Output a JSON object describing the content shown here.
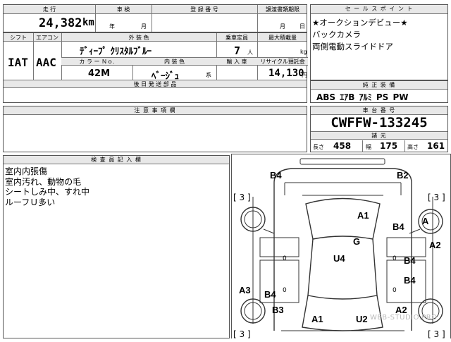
{
  "basic": {
    "h_mileage": "走 行",
    "h_inspection": "車 検",
    "h_registration": "登 録 番 号",
    "h_transfer": "譲渡書類期限",
    "mileage_value": "24,382",
    "mileage_unit": "km",
    "year_label": "年",
    "month_label": "月",
    "month_label2": "月",
    "day_label": "日"
  },
  "spec": {
    "h_shift": "シフト",
    "h_aircon": "エアコン",
    "h_exterior": "外 装 色",
    "h_capacity": "乗車定員",
    "h_load": "最大積載量",
    "shift": "IAT",
    "aircon": "AAC",
    "exterior_color": "ﾃﾞｨｰﾌﾟ ｸﾘｽﾀﾙﾌﾞﾙｰ",
    "capacity": "7",
    "capacity_unit": "人",
    "load_unit": "kg",
    "h_color_no": "カ ラ ー Ｎｏ.",
    "h_interior": "内 装 色",
    "h_import": "輸 入 車",
    "h_recycle": "リサイクル預託金",
    "color_no": "42M",
    "interior_color": "ﾍﾞｰｼﾞｭ",
    "interior_suffix": "系",
    "recycle": "14,130",
    "recycle_unit": "円",
    "h_delivery": "後 日 発 送 部 品"
  },
  "sales": {
    "header": "セ ー ル ス ポ イ ン ト",
    "lines": [
      "★オークションデビュー★",
      "バックカメラ",
      "両側電動スライドドア"
    ]
  },
  "equip": {
    "header": "純 正 装 備",
    "items": [
      "ABS",
      "ｴｱB",
      "ｱﾙﾐ",
      "PS",
      "PW"
    ]
  },
  "notes": {
    "header": "注 意 事 項 欄"
  },
  "chassis": {
    "header": "車 台 番 号",
    "number": "CWFFW-133245",
    "dims_header": "諸 元",
    "length_label": "長さ",
    "length": "458",
    "width_label": "幅",
    "width": "175",
    "height_label": "高さ",
    "height": "161"
  },
  "inspector": {
    "header": "検 査 員 記 入 欄",
    "lines": [
      "室内内張傷",
      "室内汚れ、動物の毛",
      "シートしみ中、すれ中",
      "ルーフＵ多い"
    ]
  },
  "diagram": {
    "damage_marks": [
      "B4",
      "B2",
      "A1",
      "B4",
      "A",
      "G",
      "A2",
      "U4",
      "B4",
      "B4",
      "A3",
      "B4",
      "B3",
      "A1",
      "U2",
      "A2"
    ],
    "tire_marks": [
      "[ 3 ]",
      "[ 3 ]",
      "[ 3 ]",
      "[ 3 ]"
    ],
    "zero_marks": [
      "0",
      "0",
      "0",
      "0"
    ],
    "watermark": "WEB-STUDIO.PRO"
  }
}
